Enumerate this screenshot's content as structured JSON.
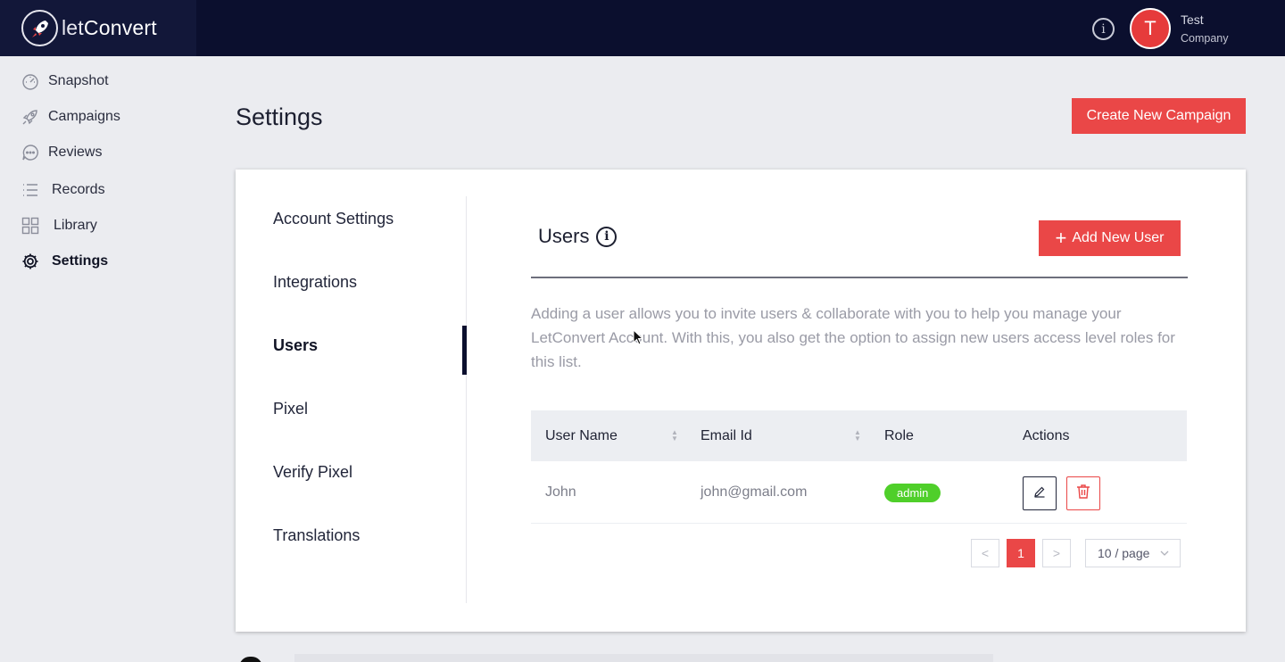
{
  "brand": {
    "name_prefix": "let",
    "name_suffix": "Convert"
  },
  "topbar": {
    "info_icon_label": "i",
    "avatar_initial": "T",
    "user_name": "Test",
    "user_company": "Company"
  },
  "sidebar": {
    "items": [
      {
        "label": "Snapshot",
        "icon": "gauge-icon"
      },
      {
        "label": "Campaigns",
        "icon": "rocket-icon"
      },
      {
        "label": "Reviews",
        "icon": "chat-bubble-icon"
      },
      {
        "label": "Records",
        "icon": "list-icon"
      },
      {
        "label": "Library",
        "icon": "grid-icon"
      },
      {
        "label": "Settings",
        "icon": "gear-icon",
        "active": true
      }
    ]
  },
  "page": {
    "title": "Settings",
    "create_button": "Create New Campaign"
  },
  "settings_tabs": [
    {
      "label": "Account Settings"
    },
    {
      "label": "Integrations"
    },
    {
      "label": "Users",
      "active": true
    },
    {
      "label": "Pixel"
    },
    {
      "label": "Verify Pixel"
    },
    {
      "label": "Translations"
    }
  ],
  "users": {
    "title": "Users",
    "info_label": "i",
    "add_button": "Add New User",
    "description": "Adding a user allows you to invite users & collaborate with you to help you manage your LetConvert Account. With this, you also get the option to assign new users access level roles for this list.",
    "columns": [
      "User Name",
      "Email Id",
      "Role",
      "Actions"
    ],
    "rows": [
      {
        "name": "John",
        "email": "john@gmail.com",
        "role": "admin"
      }
    ]
  },
  "pagination": {
    "prev": "<",
    "current": "1",
    "next": ">",
    "page_size": "10 / page"
  },
  "colors": {
    "accent": "#ea4747",
    "topbar": "#0b0f2e",
    "badge": "#4fcf2a"
  }
}
